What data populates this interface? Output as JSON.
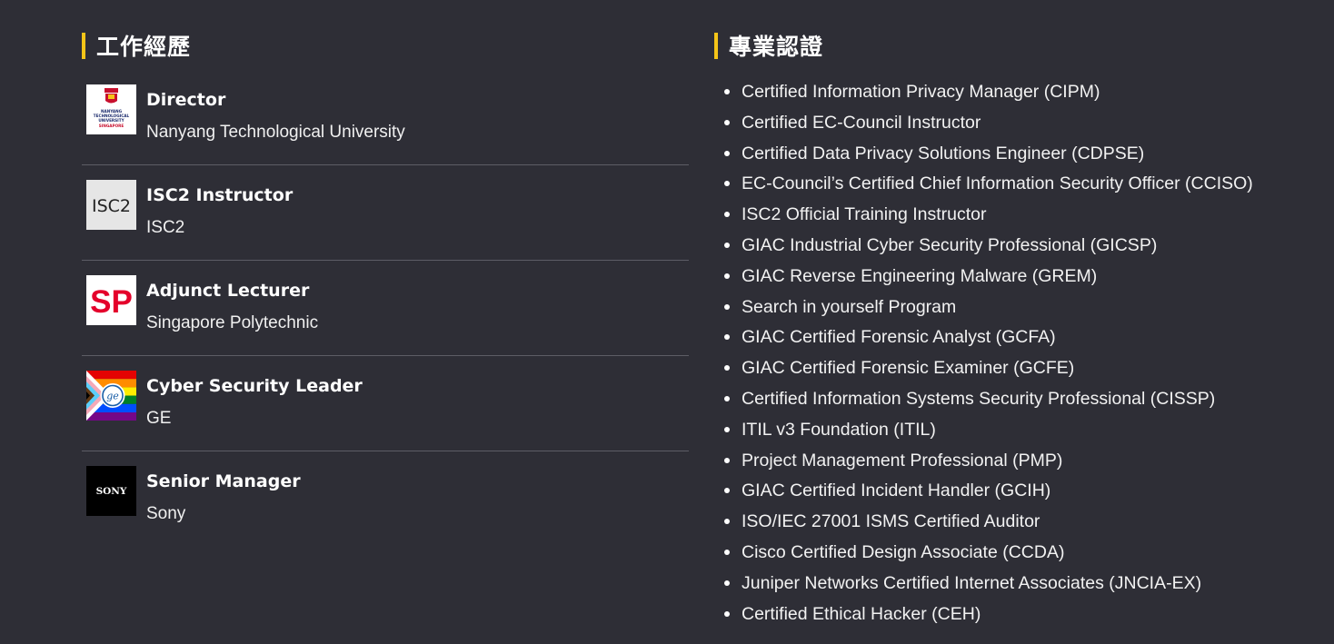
{
  "experience": {
    "heading": "工作經歷",
    "items": [
      {
        "title": "Director",
        "org": "Nanyang Technological University",
        "logo": "ntu-logo",
        "logo_text": [
          "NANYANG",
          "TECHNOLOGICAL",
          "UNIVERSITY",
          "SINGAPORE"
        ]
      },
      {
        "title": "ISC2 Instructor",
        "org": "ISC2",
        "logo": "isc2-logo",
        "logo_text": "ISC2"
      },
      {
        "title": "Adjunct Lecturer",
        "org": "Singapore Polytechnic",
        "logo": "sp-logo",
        "logo_text": "SP"
      },
      {
        "title": "Cyber Security Leader",
        "org": "GE",
        "logo": "ge-pride-logo"
      },
      {
        "title": "Senior Manager",
        "org": "Sony",
        "logo": "sony-logo",
        "logo_text": "SONY"
      }
    ]
  },
  "certifications": {
    "heading": "專業認證",
    "items": [
      "Certified Information Privacy Manager (CIPM)",
      "Certified EC-Council Instructor",
      "Certified Data Privacy Solutions Engineer (CDPSE)",
      "EC-Council’s Certified Chief Information Security Officer (CCISO)",
      "ISC2 Official Training Instructor",
      "GIAC Industrial Cyber Security Professional (GICSP)",
      "GIAC Reverse Engineering Malware (GREM)",
      "Search in yourself Program",
      "GIAC Certified Forensic Analyst (GCFA)",
      "GIAC Certified Forensic Examiner (GCFE)",
      "Certified Information Systems Security Professional (CISSP)",
      "ITIL v3 Foundation (ITIL)",
      "Project Management Professional (PMP)",
      "GIAC Certified Incident Handler (GCIH)",
      "ISO/IEC 27001 ISMS Certified Auditor",
      "Cisco Certified Design Associate (CCDA)",
      "Juniper Networks Certified Internet Associates (JNCIA-EX)",
      "Certified Ethical Hacker (CEH)"
    ]
  },
  "colors": {
    "background": "#2e2e36",
    "accent": "#f5c518",
    "divider": "#5d5d66"
  }
}
